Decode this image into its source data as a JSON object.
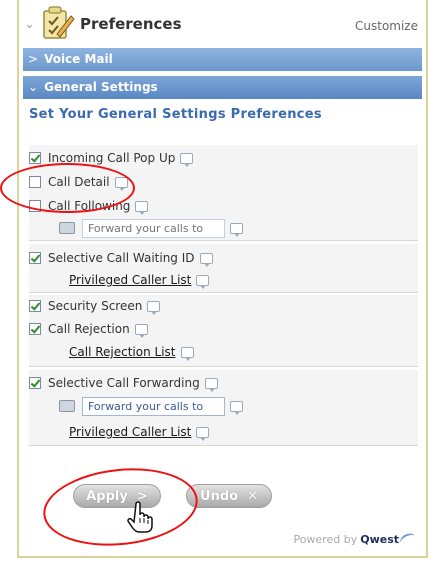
{
  "header": {
    "title": "Preferences",
    "customize_label": "Customize"
  },
  "sections": {
    "voice_mail_label": "Voice Mail",
    "general_settings_label": "General Settings"
  },
  "general": {
    "heading": "Set Your General Settings Preferences",
    "incoming_call_popup": {
      "label": "Incoming Call Pop Up",
      "checked": true
    },
    "call_detail": {
      "label": "Call Detail",
      "checked": false
    },
    "call_following": {
      "label": "Call Following",
      "checked": false,
      "forward_placeholder": "Forward your calls to"
    },
    "selective_call_waiting_id": {
      "label": "Selective Call Waiting ID",
      "checked": true,
      "list_link": "Privileged Caller List"
    },
    "security_screen": {
      "label": "Security Screen",
      "checked": true
    },
    "call_rejection": {
      "label": "Call Rejection",
      "checked": true,
      "list_link": "Call Rejection List"
    },
    "selective_call_forwarding": {
      "label": "Selective Call Forwarding",
      "checked": true,
      "forward_value": "Forward your calls to",
      "list_link": "Privileged Caller List"
    }
  },
  "actions": {
    "apply_label": "Apply",
    "undo_label": "Undo"
  },
  "footer": {
    "powered_by": "Powered by",
    "brand": "Qwest"
  },
  "icons": {
    "section_collapsed": "chevron-right-icon",
    "section_expanded": "chevron-down-icon",
    "help": "speech-bubble-icon",
    "keypad": "keypad-icon",
    "pointer": "hand-pointer-icon"
  },
  "colors": {
    "section_bar": "#6d98cc",
    "heading_blue": "#3a6ab0",
    "annotation_red": "#e11111",
    "check_green": "#2f8a2f"
  }
}
